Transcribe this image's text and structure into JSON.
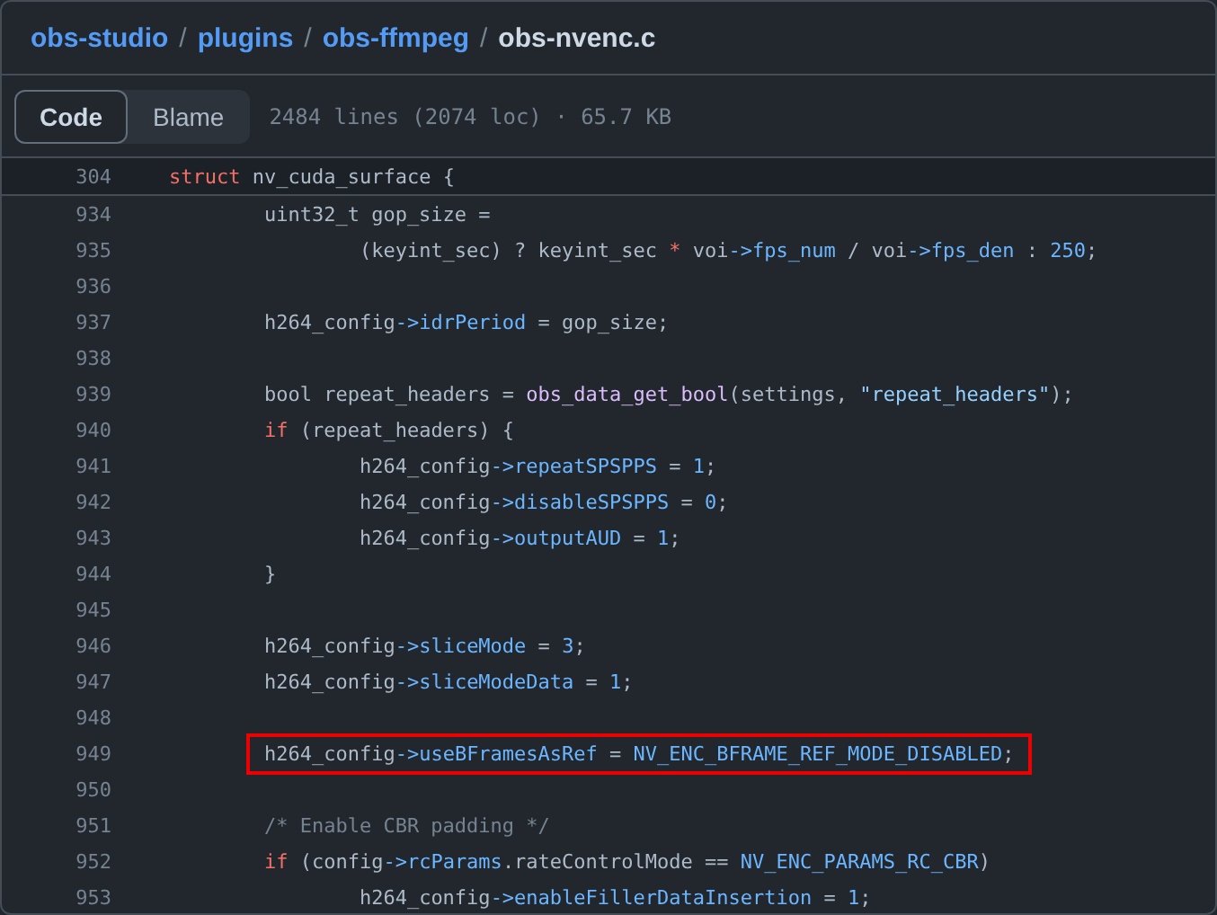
{
  "breadcrumb": [
    {
      "text": "obs-studio",
      "kind": "link"
    },
    {
      "text": "plugins",
      "kind": "link"
    },
    {
      "text": "obs-ffmpeg",
      "kind": "link"
    },
    {
      "text": "obs-nvenc.c",
      "kind": "current"
    }
  ],
  "separator": "/",
  "view_tabs": [
    {
      "label": "Code",
      "selected": true
    },
    {
      "label": "Blame",
      "selected": false
    }
  ],
  "file_info": "2484 lines (2074 loc) · 65.7 KB",
  "sticky_line": {
    "number": "304",
    "tokens": [
      {
        "text": "struct",
        "kind": "keyword"
      },
      {
        "text": " nv_cuda_surface {",
        "kind": "plain"
      }
    ]
  },
  "lines": [
    {
      "number": "934",
      "highlighted": false,
      "tokens": [
        {
          "text": "\tuint32_t gop_size =",
          "kind": "plain"
        }
      ]
    },
    {
      "number": "935",
      "highlighted": false,
      "tokens": [
        {
          "text": "\t\t(keyint_sec) ? keyint_sec ",
          "kind": "plain"
        },
        {
          "text": "*",
          "kind": "operator"
        },
        {
          "text": " voi",
          "kind": "plain"
        },
        {
          "text": "->fps_num",
          "kind": "prop"
        },
        {
          "text": " / voi",
          "kind": "plain"
        },
        {
          "text": "->fps_den",
          "kind": "prop"
        },
        {
          "text": " : ",
          "kind": "plain"
        },
        {
          "text": "250",
          "kind": "number"
        },
        {
          "text": ";",
          "kind": "plain"
        }
      ]
    },
    {
      "number": "936",
      "highlighted": false
    },
    {
      "number": "937",
      "highlighted": false,
      "tokens": [
        {
          "text": "\th264_config",
          "kind": "plain"
        },
        {
          "text": "->idrPeriod",
          "kind": "prop"
        },
        {
          "text": " = gop_size;",
          "kind": "plain"
        }
      ]
    },
    {
      "number": "938",
      "highlighted": false
    },
    {
      "number": "939",
      "highlighted": false,
      "tokens": [
        {
          "text": "\tbool repeat_headers = ",
          "kind": "plain"
        },
        {
          "text": "obs_data_get_bool",
          "kind": "func"
        },
        {
          "text": "(settings, ",
          "kind": "plain"
        },
        {
          "text": "\"repeat_headers\"",
          "kind": "string"
        },
        {
          "text": ");",
          "kind": "plain"
        }
      ]
    },
    {
      "number": "940",
      "highlighted": false,
      "tokens": [
        {
          "text": "\tif",
          "kind": "keyword"
        },
        {
          "text": " (repeat_headers) {",
          "kind": "plain"
        }
      ]
    },
    {
      "number": "941",
      "highlighted": false,
      "tokens": [
        {
          "text": "\t\th264_config",
          "kind": "plain"
        },
        {
          "text": "->repeatSPSPPS",
          "kind": "prop"
        },
        {
          "text": " = ",
          "kind": "plain"
        },
        {
          "text": "1",
          "kind": "number"
        },
        {
          "text": ";",
          "kind": "plain"
        }
      ]
    },
    {
      "number": "942",
      "highlighted": false,
      "tokens": [
        {
          "text": "\t\th264_config",
          "kind": "plain"
        },
        {
          "text": "->disableSPSPPS",
          "kind": "prop"
        },
        {
          "text": " = ",
          "kind": "plain"
        },
        {
          "text": "0",
          "kind": "number"
        },
        {
          "text": ";",
          "kind": "plain"
        }
      ]
    },
    {
      "number": "943",
      "highlighted": false,
      "tokens": [
        {
          "text": "\t\th264_config",
          "kind": "plain"
        },
        {
          "text": "->outputAUD",
          "kind": "prop"
        },
        {
          "text": " = ",
          "kind": "plain"
        },
        {
          "text": "1",
          "kind": "number"
        },
        {
          "text": ";",
          "kind": "plain"
        }
      ]
    },
    {
      "number": "944",
      "highlighted": false,
      "tokens": [
        {
          "text": "\t}",
          "kind": "plain"
        }
      ]
    },
    {
      "number": "945",
      "highlighted": false
    },
    {
      "number": "946",
      "highlighted": false,
      "tokens": [
        {
          "text": "\th264_config",
          "kind": "plain"
        },
        {
          "text": "->sliceMode",
          "kind": "prop"
        },
        {
          "text": " = ",
          "kind": "plain"
        },
        {
          "text": "3",
          "kind": "number"
        },
        {
          "text": ";",
          "kind": "plain"
        }
      ]
    },
    {
      "number": "947",
      "highlighted": false,
      "tokens": [
        {
          "text": "\th264_config",
          "kind": "plain"
        },
        {
          "text": "->sliceModeData",
          "kind": "prop"
        },
        {
          "text": " = ",
          "kind": "plain"
        },
        {
          "text": "1",
          "kind": "number"
        },
        {
          "text": ";",
          "kind": "plain"
        }
      ]
    },
    {
      "number": "948",
      "highlighted": false
    },
    {
      "number": "949",
      "highlighted": true,
      "tokens": [
        {
          "text": "\th264_config",
          "kind": "plain"
        },
        {
          "text": "->useBFramesAsRef",
          "kind": "prop"
        },
        {
          "text": " = ",
          "kind": "plain"
        },
        {
          "text": "NV_ENC_BFRAME_REF_MODE_DISABLED",
          "kind": "constant"
        },
        {
          "text": ";",
          "kind": "plain"
        }
      ]
    },
    {
      "number": "950",
      "highlighted": false
    },
    {
      "number": "951",
      "highlighted": false,
      "tokens": [
        {
          "text": "\t/* Enable CBR padding */",
          "kind": "comment"
        }
      ]
    },
    {
      "number": "952",
      "highlighted": false,
      "tokens": [
        {
          "text": "\tif",
          "kind": "keyword"
        },
        {
          "text": " (config",
          "kind": "plain"
        },
        {
          "text": "->rcParams",
          "kind": "prop"
        },
        {
          "text": ".rateControlMode == ",
          "kind": "plain"
        },
        {
          "text": "NV_ENC_PARAMS_RC_CBR",
          "kind": "constant"
        },
        {
          "text": ")",
          "kind": "plain"
        }
      ]
    },
    {
      "number": "953",
      "highlighted": false,
      "tokens": [
        {
          "text": "\t\th264_config",
          "kind": "plain"
        },
        {
          "text": "->enableFillerDataInsertion",
          "kind": "prop"
        },
        {
          "text": " = ",
          "kind": "plain"
        },
        {
          "text": "1",
          "kind": "number"
        },
        {
          "text": ";",
          "kind": "plain"
        }
      ]
    }
  ]
}
